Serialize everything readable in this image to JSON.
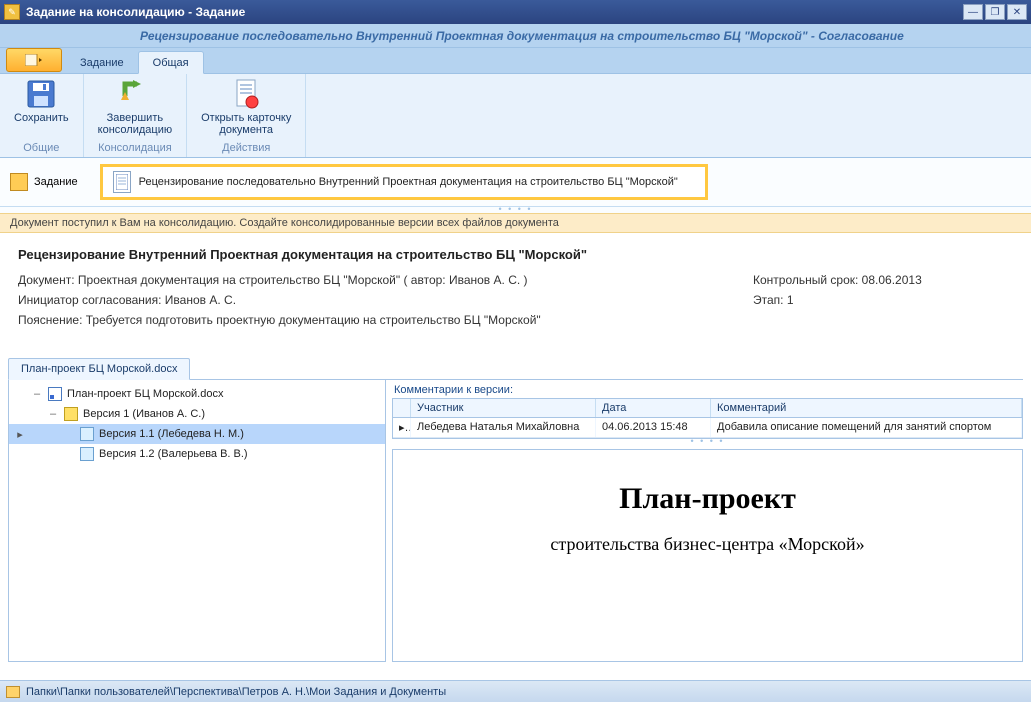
{
  "titlebar": {
    "title": "Задание на консолидацию - Задание"
  },
  "subtitle": "Рецензирование последовательно Внутренний Проектная документация на строительство БЦ \"Морской\" - Согласование",
  "tabs": {
    "t1": "Задание",
    "t2": "Общая"
  },
  "ribbon": {
    "save_label": "Сохранить",
    "finish_label": "Завершить\nконсолидацию",
    "opencard_label": "Открыть карточку\nдокумента",
    "g1": "Общие",
    "g2": "Консолидация",
    "g3": "Действия"
  },
  "taskbar": {
    "left_label": "Задание",
    "box_text": "Рецензирование последовательно Внутренний Проектная документация на строительство БЦ \"Морской\""
  },
  "banner": "Документ поступил к Вам на консолидацию. Создайте консолидированные версии всех файлов документа",
  "details": {
    "title": "Рецензирование Внутренний Проектная документация на строительство БЦ \"Морской\"",
    "doc": "Документ: Проектная документация на строительство БЦ \"Морской\" ( автор: Иванов А. С. )",
    "initiator": "Инициатор согласования: Иванов А. С.",
    "note": "Пояснение: Требуется подготовить проектную документацию на строительство БЦ \"Морской\"",
    "deadline": "Контрольный срок: 08.06.2013",
    "stage": "Этап: 1"
  },
  "filetab": "План-проект БЦ Морской.docx",
  "tree": {
    "n1": "План-проект БЦ Морской.docx",
    "n2": "Версия 1 (Иванов А. С.)",
    "n3": "Версия 1.1 (Лебедева Н. М.)",
    "n4": "Версия 1.2 (Валерьева В. В.)"
  },
  "comments": {
    "title": "Комментарии к версии:",
    "h_user": "Участник",
    "h_date": "Дата",
    "h_comment": "Комментарий",
    "rows": [
      {
        "user": "Лебедева Наталья Михайловна",
        "date": "04.06.2013 15:48",
        "comment": "Добавила описание помещений для занятий спортом"
      }
    ]
  },
  "preview": {
    "title": "План-проект",
    "subtitle": "строительства бизнес-центра «Морской»"
  },
  "statusbar": "Папки\\Папки пользователей\\Перспектива\\Петров А. Н.\\Мои Задания и Документы"
}
